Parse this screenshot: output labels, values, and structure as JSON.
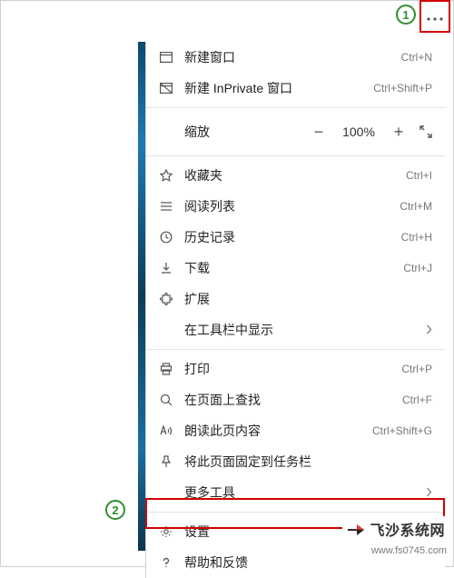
{
  "callouts": {
    "c1": "1",
    "c2": "2"
  },
  "zoom": {
    "label": "缩放",
    "minus": "−",
    "pct": "100%",
    "plus": "+"
  },
  "menu": {
    "new_window": {
      "label": "新建窗口",
      "shortcut": "Ctrl+N"
    },
    "new_inprivate": {
      "label": "新建 InPrivate 窗口",
      "shortcut": "Ctrl+Shift+P"
    },
    "favorites": {
      "label": "收藏夹",
      "shortcut": "Ctrl+I"
    },
    "reading_list": {
      "label": "阅读列表",
      "shortcut": "Ctrl+M"
    },
    "history": {
      "label": "历史记录",
      "shortcut": "Ctrl+H"
    },
    "downloads": {
      "label": "下载",
      "shortcut": "Ctrl+J"
    },
    "extensions": {
      "label": "扩展"
    },
    "show_in_toolbar": {
      "label": "在工具栏中显示"
    },
    "print": {
      "label": "打印",
      "shortcut": "Ctrl+P"
    },
    "find": {
      "label": "在页面上查找",
      "shortcut": "Ctrl+F"
    },
    "read_aloud": {
      "label": "朗读此页内容",
      "shortcut": "Ctrl+Shift+G"
    },
    "pin_taskbar": {
      "label": "将此页面固定到任务栏"
    },
    "more_tools": {
      "label": "更多工具"
    },
    "settings": {
      "label": "设置"
    },
    "help": {
      "label": "帮助和反馈"
    }
  },
  "watermark": {
    "brand": "飞沙系统网",
    "url": "www.fs0745.com"
  }
}
